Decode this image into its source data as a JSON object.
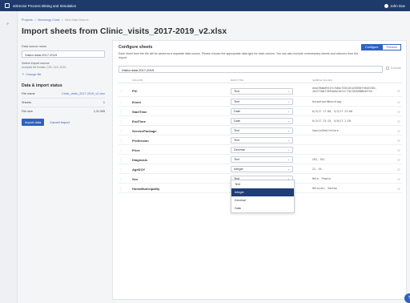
{
  "app": {
    "title": "xDirector Process Mining and Simulation",
    "user": "John Doe"
  },
  "breadcrumb": [
    "Projects",
    "Neurology Clinic",
    "New Data Source"
  ],
  "page_title": "Import sheets from Clinic_visits_2017-2019_v2.xlsx",
  "left": {
    "ds_name_label": "Data source name",
    "ds_name_value": "Visitor data 2017-2019",
    "source_label": "Select import source",
    "source_value": "Accepted file formats: CSV, XLS, XLSX",
    "change_file": "Change file",
    "status_title": "Data & import status",
    "file_name_label": "File name",
    "file_name_value": "Clinic_visits_2017-2019_v2.xlsx",
    "sheets_label": "Sheets",
    "sheets_value": "1",
    "size_label": "File size",
    "size_value": "1,31 MB",
    "import_btn": "Import data",
    "cancel_btn": "Cancel import"
  },
  "config": {
    "title": "Configure sheets",
    "desc": "Each sheet from the file will be saved as a separate data source. Please choose the appropriate data type for each column. You can also exclude unnecessary sheets and columns from the import.",
    "toggle_configure": "Configure",
    "toggle_preview": "Preview",
    "sheet_name": "Visitor data 2017-2019",
    "exclude": "Exclude",
    "headers": {
      "column": "COLUMN",
      "type": "DATA TYPE",
      "sample": "SAMPLE VALUES"
    },
    "rows": [
      {
        "name": "PIC",
        "type": "Text",
        "sample1": "eea196ab6941fc7e6bc733e161d3389a7f6a61362,",
        "sample2": "4ee7f3b817095a0ac3d7cc77b1363d988b49f54"
      },
      {
        "name": "Event",
        "type": "Text",
        "sample1": "OutpatientNeurology",
        "sample2": ""
      },
      {
        "name": "StartTime",
        "type": "Date",
        "sample1": "6/3/17 17:00, 5/3/17 23:00",
        "sample2": ""
      },
      {
        "name": "EndTime",
        "type": "Date",
        "sample1": "6/3/17 23:15, 5/8/17 2:20",
        "sample2": ""
      },
      {
        "name": "ServicePackage",
        "type": "Text",
        "sample1": "SpecialHealthCare",
        "sample2": ""
      },
      {
        "name": "Profession",
        "type": "Text",
        "sample1": "",
        "sample2": ""
      },
      {
        "name": "Price",
        "type": "Decimal",
        "sample1": "",
        "sample2": ""
      },
      {
        "name": "Diagnosis",
        "type": "Text",
        "sample1": "I63, I61",
        "sample2": ""
      },
      {
        "name": "AgeDOY",
        "type": "Integer",
        "sample1": "21, 54",
        "sample2": ""
      },
      {
        "name": "Sex",
        "type": "Text",
        "sample1": "Male, Female",
        "sample2": ""
      },
      {
        "name": "HomeMunicipality",
        "type": "Text",
        "sample1": "Helsinki, Vantaa",
        "sample2": ""
      }
    ],
    "dropdown": [
      "Text",
      "Integer",
      "Decimal",
      "Date"
    ]
  }
}
